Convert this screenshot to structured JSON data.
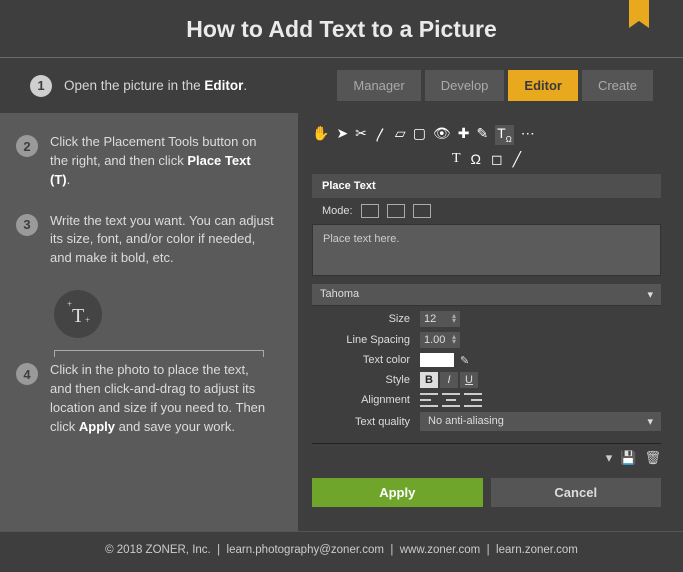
{
  "title": "How to Add Text to a Picture",
  "tabs": [
    "Manager",
    "Develop",
    "Editor",
    "Create"
  ],
  "steps": [
    {
      "num": "1",
      "pre": "Open the picture in the ",
      "bold": "Editor",
      "post": "."
    },
    {
      "num": "2",
      "pre": "Click the Placement Tools button on the right, and then click ",
      "bold": "Place Text (T)",
      "post": "."
    },
    {
      "num": "3",
      "pre": "Write the text you want. You can adjust its size, font, and/or color if needed, and make it bold, etc."
    },
    {
      "num": "4",
      "pre": "Click in the photo to place the text, and then click-and-drag to adjust its location and size if you need to. Then click ",
      "bold": "Apply",
      "post": " and save your work."
    }
  ],
  "panel": {
    "header": "Place Text",
    "modeLabel": "Mode:",
    "placeholder": "Place text here.",
    "font": "Tahoma",
    "sizeLabel": "Size",
    "size": "12",
    "lineSpacingLabel": "Line Spacing",
    "lineSpacing": "1.00",
    "textColorLabel": "Text color",
    "styleLabel": "Style",
    "alignLabel": "Alignment",
    "qualityLabel": "Text quality",
    "quality": "No anti-aliasing",
    "apply": "Apply",
    "cancel": "Cancel"
  },
  "footer": {
    "copyright": "© 2018 ZONER, Inc.",
    "email": "learn.photography@zoner.com",
    "site1": "www.zoner.com",
    "site2": "learn.zoner.com"
  }
}
